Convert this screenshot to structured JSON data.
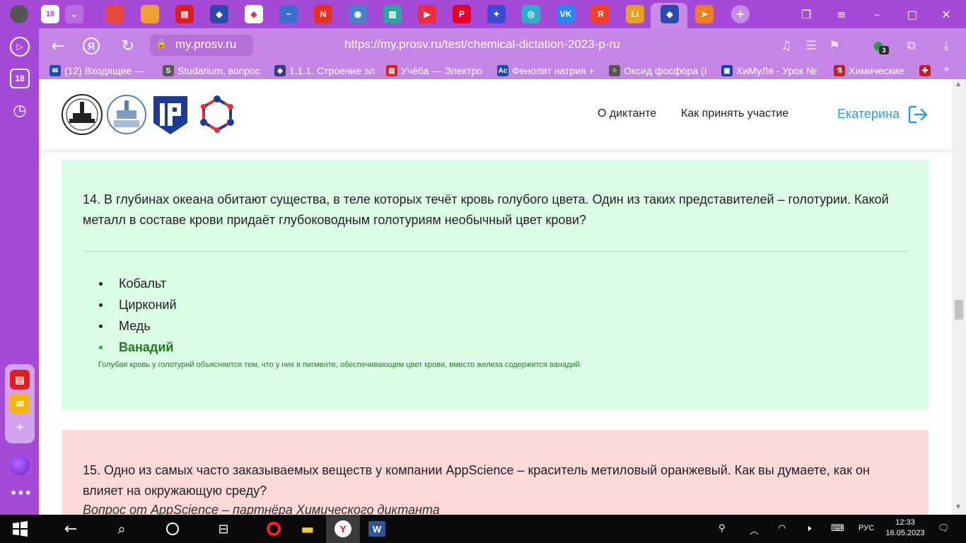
{
  "browser": {
    "tab_count": "18",
    "url_domain": "my.prosv.ru",
    "url_full": "https://my.prosv.ru/test/chemical-dictation-2023-p-ru",
    "extension_badge": "3",
    "tabs": [
      {
        "name": "tab-windows",
        "glyph": "",
        "color": "#e5493a"
      },
      {
        "name": "tab-windows-2",
        "glyph": "",
        "color": "#f0a030"
      },
      {
        "name": "tab-doc",
        "glyph": "▤",
        "color": "#e21b1b"
      },
      {
        "name": "tab-prosv",
        "glyph": "◆",
        "color": "#2c4aa8"
      },
      {
        "name": "tab-app",
        "glyph": "◈",
        "color": "#ffffff"
      },
      {
        "name": "tab-wing",
        "glyph": "~",
        "color": "#3a6fd0"
      },
      {
        "name": "tab-n",
        "glyph": "N",
        "color": "#e83020"
      },
      {
        "name": "tab-globe",
        "glyph": "◉",
        "color": "#4a82c8"
      },
      {
        "name": "tab-book",
        "glyph": "▥",
        "color": "#2aa5a0"
      },
      {
        "name": "tab-video",
        "glyph": "▶",
        "color": "#ee2a3c"
      },
      {
        "name": "tab-pinterest",
        "glyph": "P",
        "color": "#e60023"
      },
      {
        "name": "tab-rocket",
        "glyph": "✦",
        "color": "#3a4bd0"
      },
      {
        "name": "tab-circle",
        "glyph": "◎",
        "color": "#2ab0c8"
      },
      {
        "name": "tab-vk",
        "glyph": "VK",
        "color": "#2787f5"
      },
      {
        "name": "tab-yandex",
        "glyph": "Я",
        "color": "#fc3f1d"
      },
      {
        "name": "tab-lit",
        "glyph": "Li",
        "color": "#e8a020"
      },
      {
        "name": "tab-prosv-active",
        "glyph": "◆",
        "color": "#2c4aa8"
      },
      {
        "name": "tab-plane",
        "glyph": "➤",
        "color": "#f07f1f"
      }
    ]
  },
  "bookmarks": [
    {
      "label": "(12) Входящие — ",
      "icon": "✉",
      "color": "#1a4fa8"
    },
    {
      "label": "Studarium, вопрос",
      "icon": "S",
      "color": "#5a5a5a"
    },
    {
      "label": "1.1.1. Строение эл",
      "icon": "◆",
      "color": "#3a3a8a"
    },
    {
      "label": "Учёба — Электро",
      "icon": "▤",
      "color": "#e21b1b"
    },
    {
      "label": "Фенолят натрия +",
      "icon": "Ac",
      "color": "#1a4fa8"
    },
    {
      "label": "Оксид фосфора (I",
      "icon": "⁘",
      "color": "#555555"
    },
    {
      "label": "ХиМуЛя - Урок №",
      "icon": "▣",
      "color": "#1a3fa0"
    },
    {
      "label": "Химические",
      "icon": "⚗",
      "color": "#c02020"
    },
    {
      "label": "",
      "icon": "✚",
      "color": "#c81e2a"
    }
  ],
  "sidebar": {
    "tab_count": "18"
  },
  "site": {
    "nav_about": "О диктанте",
    "nav_how": "Как принять участие",
    "user_name": "Екатерина"
  },
  "questions": {
    "q14": {
      "text": "14. В глубинах океана обитают существа, в теле которых течёт кровь голубого цвета. Один из таких представителей – голотурии. Какой металл в составе крови придаёт глубоководным голотуриям необычный цвет крови?",
      "options": [
        "Кобальт",
        "Цирконий",
        "Медь",
        "Ванадий"
      ],
      "correct_index": 3,
      "explanation": "Голубая кровь у голотурий объясняется тем, что у них в пигменте, обеспечивающем цвет крови, вместо железа содержится ванадий."
    },
    "q15": {
      "text": "15. Одно из самых часто заказываемых веществ у компании AppScience – краситель метиловый оранжевый. Как вы думаете, как он влияет на окружающую среду?",
      "subtext": "Вопрос от AppScience – партнёра Химического диктанта"
    }
  },
  "colors": {
    "chrome": "#a54ad6",
    "addrbar": "#c585e6",
    "correct_card": "#dbfce5",
    "wrong_card": "#fdd9d9",
    "correct_text": "#1d7d1d",
    "accent_blue": "#2a9fd8"
  },
  "taskbar": {
    "lang": "РУС",
    "time": "12:33",
    "date": "16.05.2023"
  }
}
